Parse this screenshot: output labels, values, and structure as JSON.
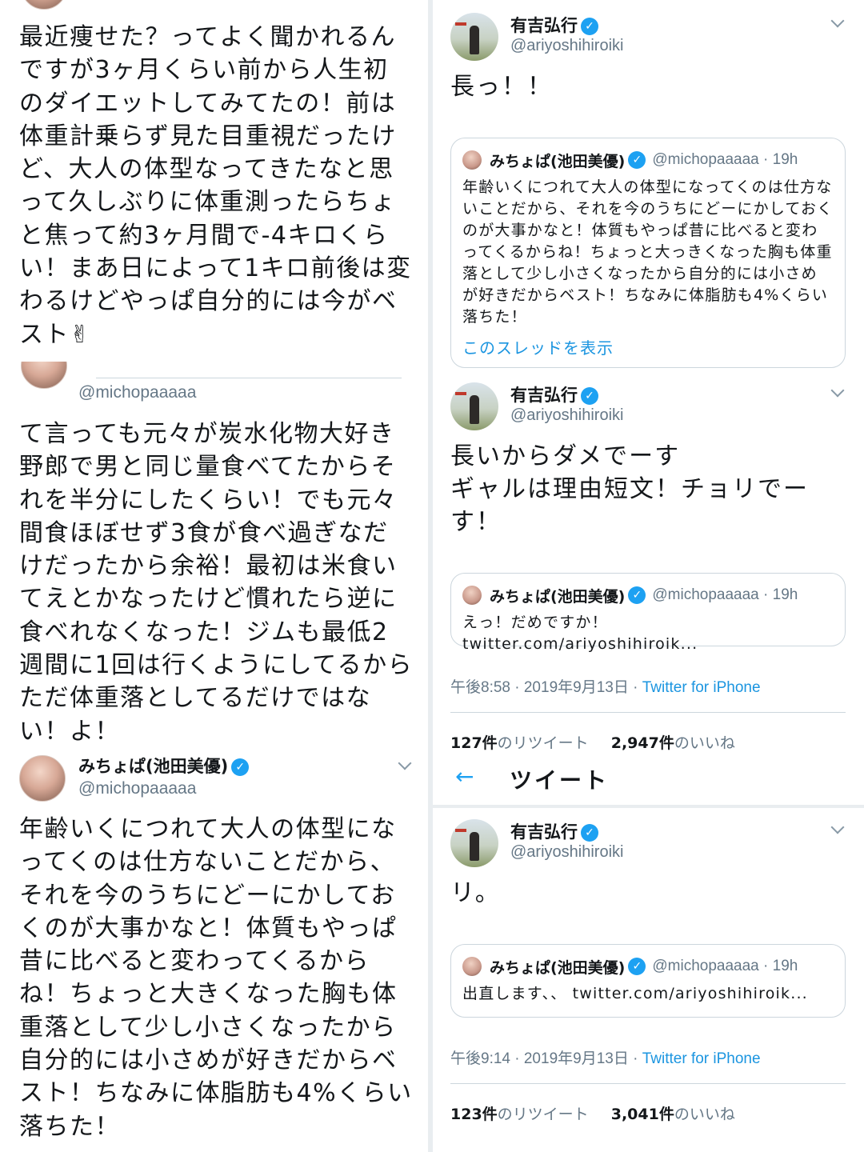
{
  "left": {
    "panel1": {
      "text": "最近痩せた？ってよく聞かれるんですが3ヶ月くらい前から人生初のダイエットしてみてたの！前は体重計乗らず見た目重視だったけど、大人の体型なってきたなと思って久しぶりに体重測ったらちょと焦って約3ヶ月間で-4キロくらい！まあ日によって1キロ前後は変わるけどやっぱ自分的には今がベスト✌"
    },
    "panel2": {
      "handle": "@michopaaaaa",
      "text": "て言っても元々が炭水化物大好き野郎で男と同じ量食べてたからそれを半分にしたくらい！でも元々間食ほぼせず3食が食べ過ぎなだけだったから余裕！最初は米食いてえとかなったけど慣れたら逆に食べれなくなった！ジムも最低2週間に1回は行くようにしてるからただ体重落としてるだけではない！よ！"
    },
    "panel3": {
      "name": "みちょぱ(池田美優)",
      "handle": "@michopaaaaa",
      "text": "年齢いくにつれて大人の体型になってくのは仕方ないことだから、それを今のうちにどーにかしておくのが大事かなと！体質もやっぱ昔に比べると変わってくるからね！ちょっと大きくなった胸も体重落として少し小さくなったから自分的には小さめが好きだからベスト！ちなみに体脂肪も4%くらい落ちた！"
    }
  },
  "right": {
    "tweet1": {
      "name": "有吉弘行",
      "handle": "@ariyoshihiroiki",
      "text": "長っ！！",
      "quote": {
        "name": "みちょぱ(池田美優)",
        "handle": "@michopaaaaa · 19h",
        "text": "年齢いくにつれて大人の体型になってくのは仕方ないことだから、それを今のうちにどーにかしておくのが大事かなと！体質もやっぱ昔に比べると変わってくるからね！ちょっと大っきくなった胸も体重落として少し小さくなったから自分的には小さめが好きだからベスト！ちなみに体脂肪も4%くらい落ちた！",
        "link": "このスレッドを表示"
      }
    },
    "tweet2": {
      "name": "有吉弘行",
      "handle": "@ariyoshihiroiki",
      "text": "長いからダメでーす\nギャルは理由短文！チョリでーす！",
      "quote": {
        "name": "みちょぱ(池田美優)",
        "handle": "@michopaaaaa · 19h",
        "text": "えっ！だめですか！ twitter.com/ariyoshihiroik..."
      },
      "meta_time": "午後8:58 · 2019年9月13日 · ",
      "meta_source": "Twitter for iPhone",
      "retweets": "127件",
      "retweets_label": "のリツイート",
      "likes": "2,947件",
      "likes_label": "のいいね"
    },
    "nav": {
      "back_icon": "←",
      "title": "ツイート"
    },
    "tweet3": {
      "name": "有吉弘行",
      "handle": "@ariyoshihiroiki",
      "text": "リ。",
      "quote": {
        "name": "みちょぱ(池田美優)",
        "handle": "@michopaaaaa · 19h",
        "text": "出直します、、 twitter.com/ariyoshihiroik..."
      },
      "meta_time": "午後9:14 · 2019年9月13日 · ",
      "meta_source": "Twitter for iPhone",
      "retweets": "123件",
      "retweets_label": "のリツイート",
      "likes": "3,041件",
      "likes_label": "のいいね"
    }
  },
  "icons": {
    "verified": "verified-badge-icon",
    "chevron": "chevron-down-icon",
    "back": "back-arrow-icon"
  },
  "colors": {
    "twitter_blue": "#1da1f2",
    "link_blue": "#1b95e0",
    "muted": "#657786",
    "border": "#ccd6dd"
  }
}
